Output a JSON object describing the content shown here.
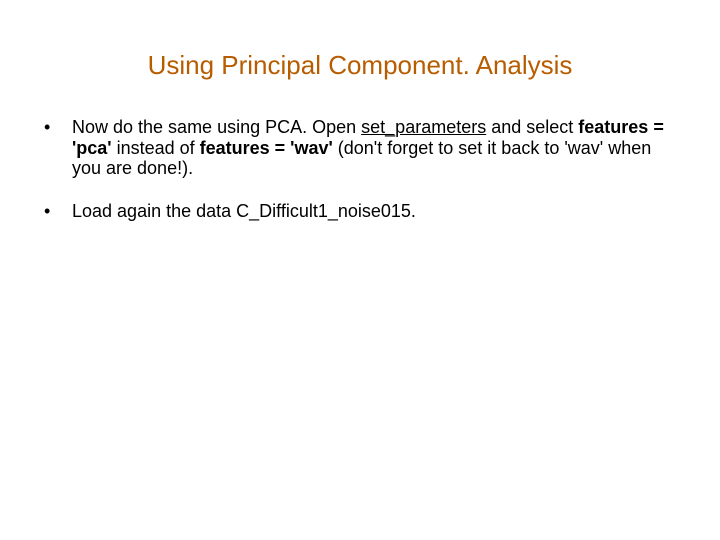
{
  "title": "Using Principal Component. Analysis",
  "bullets": [
    {
      "dot": "•",
      "parts": {
        "p0": "Now do the same using PCA. Open ",
        "u1": "set_parameters",
        "p2": " and select ",
        "b3": "features = 'pca'",
        "p4": " instead of ",
        "b5": "features = 'wav'",
        "p6": " (don't forget to set it back to 'wav' when you are done!)."
      }
    },
    {
      "dot": "•",
      "parts": {
        "p0": "Load again the data C_Difficult1_noise015."
      }
    }
  ]
}
